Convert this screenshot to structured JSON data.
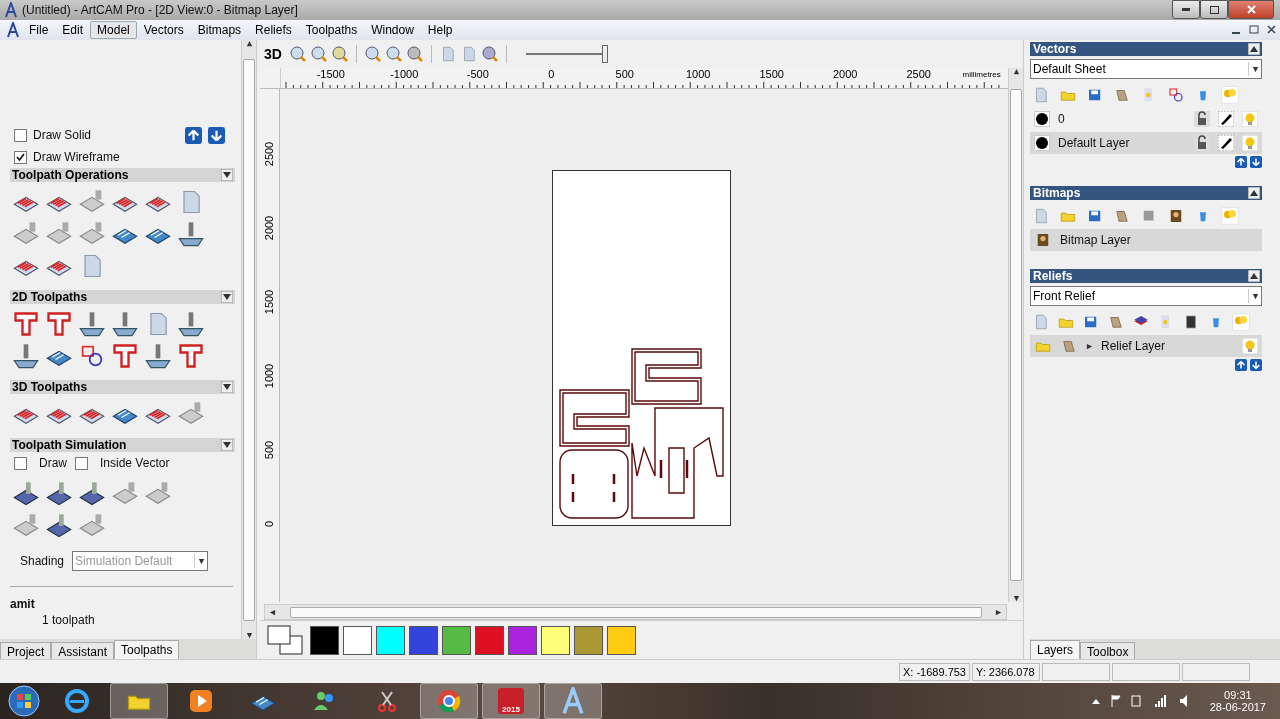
{
  "window": {
    "title": "(Untitled) - ArtCAM Pro - [2D View:0 - Bitmap Layer]"
  },
  "menu": [
    {
      "label": "File",
      "selected": false
    },
    {
      "label": "Edit",
      "selected": false
    },
    {
      "label": "Model",
      "selected": true
    },
    {
      "label": "Vectors",
      "selected": false
    },
    {
      "label": "Bitmaps",
      "selected": false
    },
    {
      "label": "Reliefs",
      "selected": false
    },
    {
      "label": "Toolpaths",
      "selected": false
    },
    {
      "label": "Window",
      "selected": false
    },
    {
      "label": "Help",
      "selected": false
    }
  ],
  "left_panel": {
    "checks": [
      {
        "label": "Draw Solid",
        "checked": false
      },
      {
        "label": "Draw Wireframe",
        "checked": true
      }
    ],
    "sections": [
      {
        "title": "Toolpath Operations"
      },
      {
        "title": "2D Toolpaths"
      },
      {
        "title": "3D Toolpaths"
      }
    ],
    "simulation": {
      "title": "Toolpath Simulation",
      "options": [
        {
          "label": "Draw",
          "checked": false
        },
        {
          "label": "Inside Vector",
          "checked": false
        }
      ],
      "shading_label": "Shading",
      "shading_value": "Simulation Default"
    },
    "toolpaths": {
      "group": "amit",
      "count": "1 toolpath"
    },
    "tabs": [
      {
        "label": "Project",
        "selected": false
      },
      {
        "label": "Assistant",
        "selected": false
      },
      {
        "label": "Toolpaths",
        "selected": true
      }
    ]
  },
  "view": {
    "mode_label": "3D",
    "slider": {
      "level": 1
    },
    "x_labels": [
      "-1500",
      "-1000",
      "-500",
      "0",
      "500",
      "1000",
      "1500",
      "2000",
      "2500"
    ],
    "unit": "millimetres",
    "y_labels": [
      "2500",
      "2000",
      "1500",
      "1000",
      "500",
      "0"
    ]
  },
  "palette": [
    {
      "color": "#000000"
    },
    {
      "color": "#ffffff"
    },
    {
      "color": "#00ffff"
    },
    {
      "color": "#3344dd"
    },
    {
      "color": "#55bb44"
    },
    {
      "color": "#dd1122"
    },
    {
      "color": "#aa22dd"
    },
    {
      "color": "#ffff77"
    },
    {
      "color": "#aa9933"
    },
    {
      "color": "#ffcc11"
    }
  ],
  "right_panel": {
    "vectors": {
      "title": "Vectors",
      "sheet": "Default Sheet",
      "layers": [
        {
          "name": "0",
          "selected": false
        },
        {
          "name": "Default Layer",
          "selected": true
        }
      ]
    },
    "bitmaps": {
      "title": "Bitmaps",
      "layers": [
        {
          "name": "Bitmap Layer",
          "selected": true
        }
      ]
    },
    "reliefs": {
      "title": "Reliefs",
      "relief": "Front Relief",
      "layers": [
        {
          "name": "Relief Layer",
          "selected": true
        }
      ]
    },
    "tabs": [
      {
        "label": "Layers",
        "selected": true
      },
      {
        "label": "Toolbox",
        "selected": false
      }
    ]
  },
  "status_bar": {
    "x": "X: -1689.753",
    "y": "Y: 2366.078"
  },
  "taskbar": {
    "sw_badge": "2015",
    "time": "09:31",
    "date": "28-06-2017"
  }
}
